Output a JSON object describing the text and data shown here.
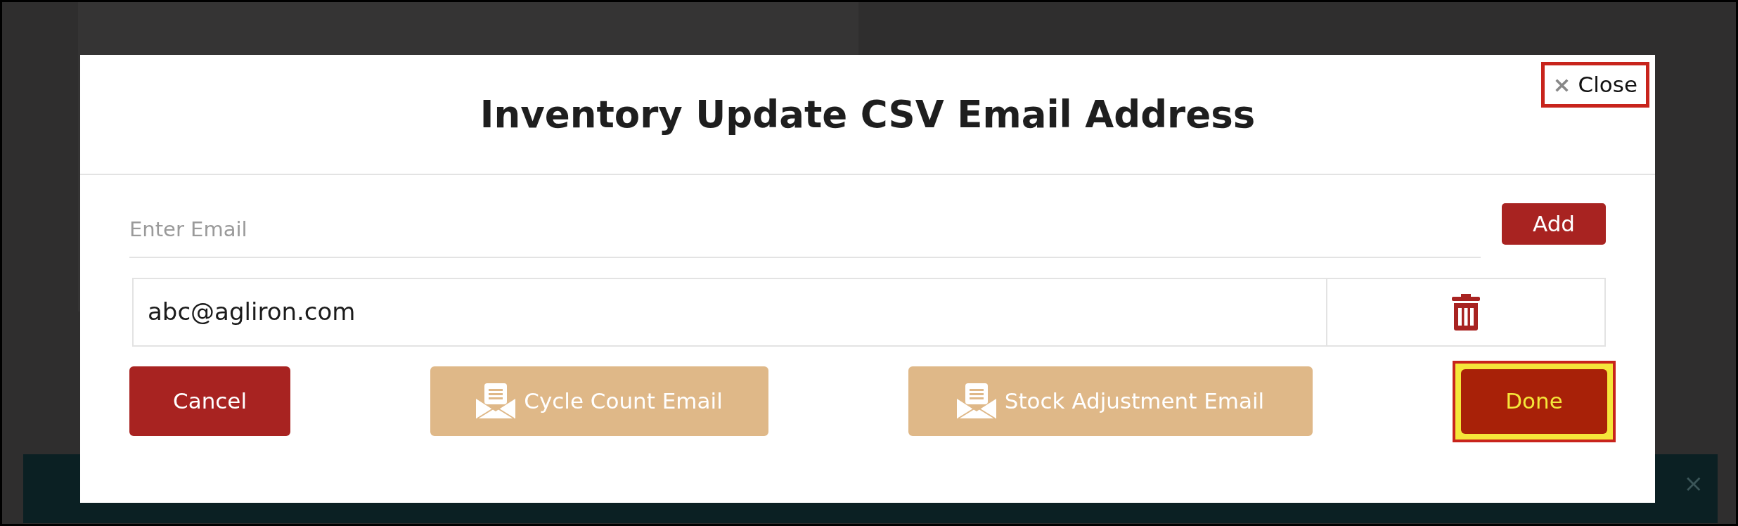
{
  "modal": {
    "title": "Inventory Update CSV Email Address",
    "close": {
      "icon": "×",
      "label": "Close"
    },
    "email_field": {
      "placeholder": "Enter Email"
    },
    "add_button": "Add",
    "emails": [
      {
        "address": "abc@agliron.com"
      }
    ],
    "buttons": [
      {
        "kind": "cancel",
        "label": "Cancel"
      },
      {
        "kind": "email",
        "label": "Cycle Count Email"
      },
      {
        "kind": "email",
        "label": "Stock Adjustment Email"
      },
      {
        "kind": "done",
        "label": "Done"
      }
    ]
  },
  "toast": {
    "close": "×"
  }
}
